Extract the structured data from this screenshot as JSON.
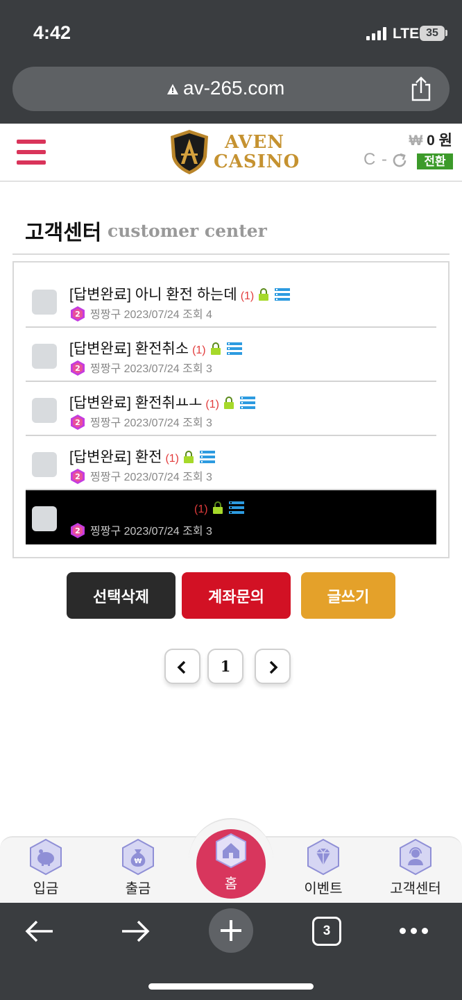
{
  "status_bar": {
    "time": "4:42",
    "network": "LTE",
    "battery": "35"
  },
  "browser": {
    "url": "av-265.com",
    "tab_count": "3"
  },
  "header": {
    "logo_line1": "AVEN",
    "logo_line2": "CASINO",
    "balance_currency": "₩",
    "balance_amount": "0 원",
    "point_text": "C -",
    "convert_label": "전환"
  },
  "page": {
    "title_ko": "고객센터",
    "title_en": "customer center"
  },
  "posts": [
    {
      "subject": "[답변완료] 아니 환전 하는데",
      "comments": "(1)",
      "author": "찡짱구",
      "date": "2023/07/24",
      "views": "조회 4"
    },
    {
      "subject": "[답변완료] 환전취소",
      "comments": "(1)",
      "author": "찡짱구",
      "date": "2023/07/24",
      "views": "조회 3"
    },
    {
      "subject": "[답변완료] 환전취ㅛㅗ",
      "comments": "(1)",
      "author": "찡짱구",
      "date": "2023/07/24",
      "views": "조회 3"
    },
    {
      "subject": "[답변완료] 환전",
      "comments": "(1)",
      "author": "찡짱구",
      "date": "2023/07/24",
      "views": "조회 3"
    },
    {
      "subject": "",
      "comments": "(1)",
      "author": "찡짱구",
      "date": "2023/07/24",
      "views": "조회 3"
    }
  ],
  "actions": {
    "delete_selected": "선택삭제",
    "account_inquiry": "계좌문의",
    "write": "글쓰기"
  },
  "pagination": {
    "current": "1"
  },
  "bottom_nav": [
    {
      "label": "입금",
      "icon": "piggy-bank-icon"
    },
    {
      "label": "출금",
      "icon": "money-bag-icon"
    },
    {
      "label": "홈",
      "icon": "house-icon"
    },
    {
      "label": "이벤트",
      "icon": "diamond-icon"
    },
    {
      "label": "고객센터",
      "icon": "support-agent-icon"
    }
  ],
  "colors": {
    "accent": "#d8365d",
    "gold": "#c59230",
    "nav_icon": "#8f8fd6",
    "convert": "#3c9a2a",
    "account_btn": "#d21124",
    "write_btn": "#e4a12a"
  }
}
